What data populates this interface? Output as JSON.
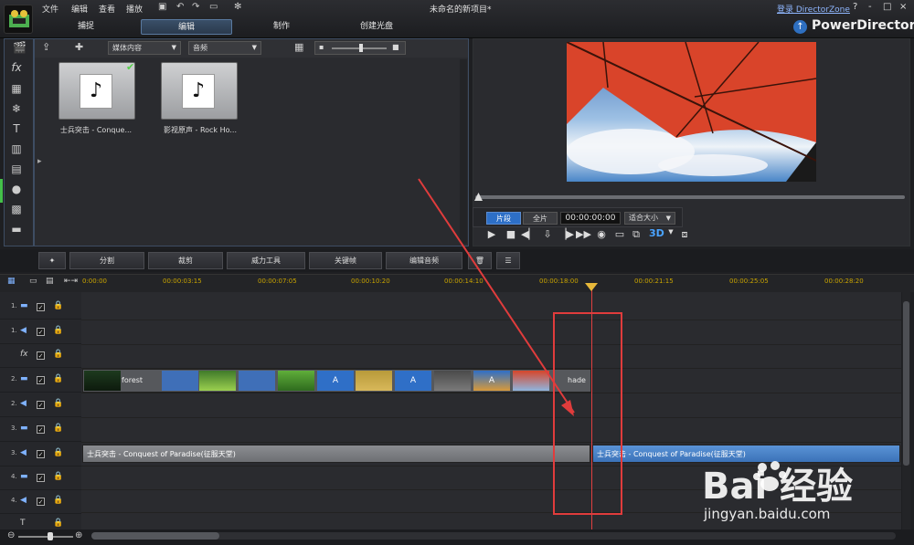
{
  "menubar": {
    "items": [
      "文件",
      "编辑",
      "查看",
      "播放"
    ],
    "project_title": "未命名的新项目*",
    "login_link": "登录 DirectorZone",
    "window_buttons": [
      "?",
      "-",
      "□",
      "×"
    ]
  },
  "mode_tabs": [
    "捕捉",
    "编辑",
    "制作",
    "创建光盘"
  ],
  "active_mode": "编辑",
  "brand": "PowerDirector",
  "library": {
    "filter_dropdown": "媒体内容",
    "type_dropdown": "音频",
    "items": [
      {
        "label": "士兵突击 - Conque...",
        "checked": true
      },
      {
        "label": "影视原声 - Rock Ho...",
        "checked": false
      }
    ]
  },
  "preview": {
    "segment_clip": "片段",
    "segment_full": "全片",
    "timecode": "00:00:00:00",
    "fit_dropdown": "适合大小",
    "stereo_label": "3D"
  },
  "edit_toolbar": [
    "分割",
    "裁剪",
    "威力工具",
    "关键帧",
    "编辑音频"
  ],
  "ruler_ticks": [
    "0:00:00",
    "00:00:03:15",
    "00:00:07:05",
    "00:00:10:20",
    "00:00:14:10",
    "00:00:18:00",
    "00:00:21:15",
    "00:00:25:05",
    "00:00:28:20"
  ],
  "tracks": [
    {
      "num": "1.",
      "kind": "video"
    },
    {
      "num": "1.",
      "kind": "audio"
    },
    {
      "num": "",
      "kind": "fx"
    },
    {
      "num": "2.",
      "kind": "video"
    },
    {
      "num": "2.",
      "kind": "audio"
    },
    {
      "num": "3.",
      "kind": "video"
    },
    {
      "num": "3.",
      "kind": "audio"
    },
    {
      "num": "4.",
      "kind": "video"
    },
    {
      "num": "4.",
      "kind": "audio"
    },
    {
      "num": "",
      "kind": "title"
    }
  ],
  "video_clip_labels": {
    "first": "forest",
    "last": "hade"
  },
  "audio_clips": [
    {
      "label": "士兵突击 - Conquest of Paradise(征服天堂)"
    },
    {
      "label": "士兵突击 - Conquest of Paradise(征服天堂)"
    }
  ],
  "watermark": {
    "text": "Bai 经验",
    "url": "jingyan.baidu.com"
  },
  "colors": {
    "accent": "#2d6fc7",
    "annotation": "#e03c3c",
    "playhead": "#e04040"
  }
}
